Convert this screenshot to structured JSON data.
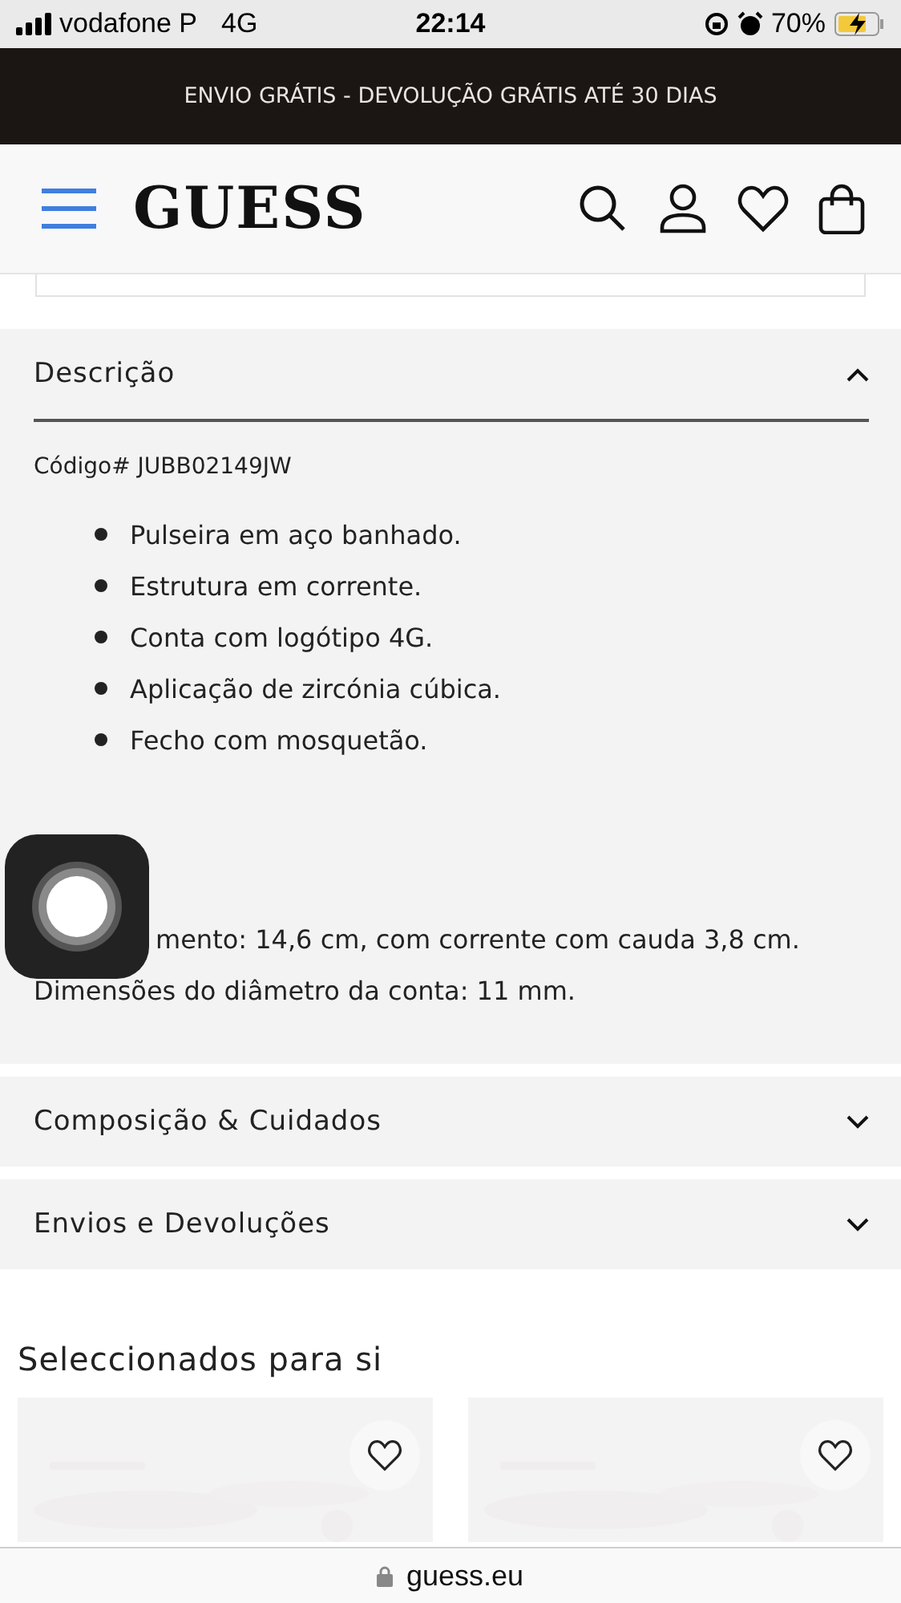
{
  "status_bar": {
    "carrier": "vodafone P",
    "network": "4G",
    "time": "22:14",
    "battery": "70%"
  },
  "promo_banner": "ENVIO GRÁTIS - DEVOLUÇÃO GRÁTIS ATÉ 30 DIAS",
  "header": {
    "logo": "GUESS"
  },
  "sections": [
    {
      "title": "Descrição",
      "expanded": true,
      "code": "Código# JUBB02149JW",
      "bullets": [
        "Pulseira em aço banhado.",
        "Estrutura em corrente.",
        "Conta com logótipo 4G.",
        "Aplicação de zircónia cúbica.",
        "Fecho com mosquetão."
      ],
      "details": [
        "mento: 14,6 cm, com corrente com cauda 3,8 cm.",
        "Dimensões do diâmetro da conta: 11 mm."
      ]
    },
    {
      "title": "Composição & Cuidados",
      "expanded": false
    },
    {
      "title": "Envios e Devoluções",
      "expanded": false
    }
  ],
  "recommendations": {
    "title": "Seleccionados para si"
  },
  "url_bar": "guess.eu"
}
